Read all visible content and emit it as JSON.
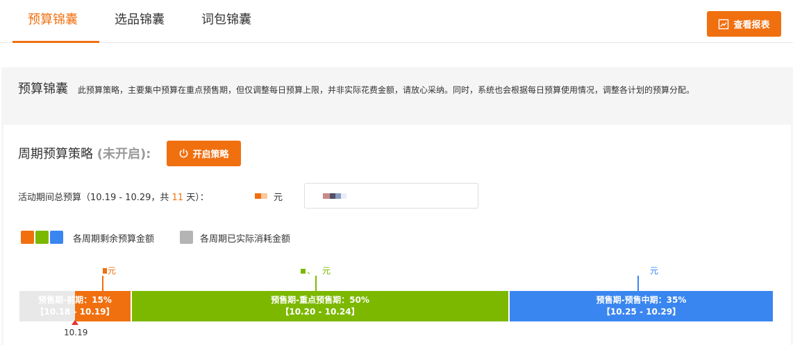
{
  "tabs": [
    {
      "label": "预算锦囊",
      "active": true
    },
    {
      "label": "选品锦囊",
      "active": false
    },
    {
      "label": "词包锦囊",
      "active": false
    }
  ],
  "report_button": {
    "label": "查看报表",
    "icon": "chart-report-icon"
  },
  "panel": {
    "title": "预算锦囊",
    "description": "此预算策略，主要集中预算在重点预售期，但仅调整每日预算上限，并非实际花费金额，请放心采纳。同时，系统也会根据每日预算使用情况，调整各计划的预算分配。"
  },
  "strategy": {
    "title": "周期预算策略",
    "status": "(未开启):",
    "open_button": {
      "label": "开启策略",
      "icon": "power-icon"
    }
  },
  "budget": {
    "label_prefix": "活动期间总预算（10.19 - 10.29，共 ",
    "days": "11",
    "label_suffix": " 天）：",
    "unit": "元"
  },
  "legend": {
    "remaining_label": "各周期剩余预算金额",
    "spent_label": "各周期已实际消耗金额"
  },
  "colors": {
    "accent": "#f07010",
    "period1": "#f07010",
    "period2": "#7cb800",
    "period3": "#3a86f0",
    "spent": "#e0e0e0",
    "marker": "#e53030"
  },
  "periods": [
    {
      "annotation_unit": "元",
      "name": "预售期-前期：15%",
      "range": "【10.18 - 10.19】",
      "share": 0.15
    },
    {
      "annotation_sep": "、",
      "annotation_unit": "元",
      "name": "预售期-重点预售期：50%",
      "range": "【10.20 - 10.24】",
      "share": 0.5
    },
    {
      "annotation_unit": "元",
      "name": "预售期-预售中期：35%",
      "range": "【10.25 - 10.29】",
      "share": 0.35
    }
  ],
  "marker": {
    "label": "10.19"
  }
}
